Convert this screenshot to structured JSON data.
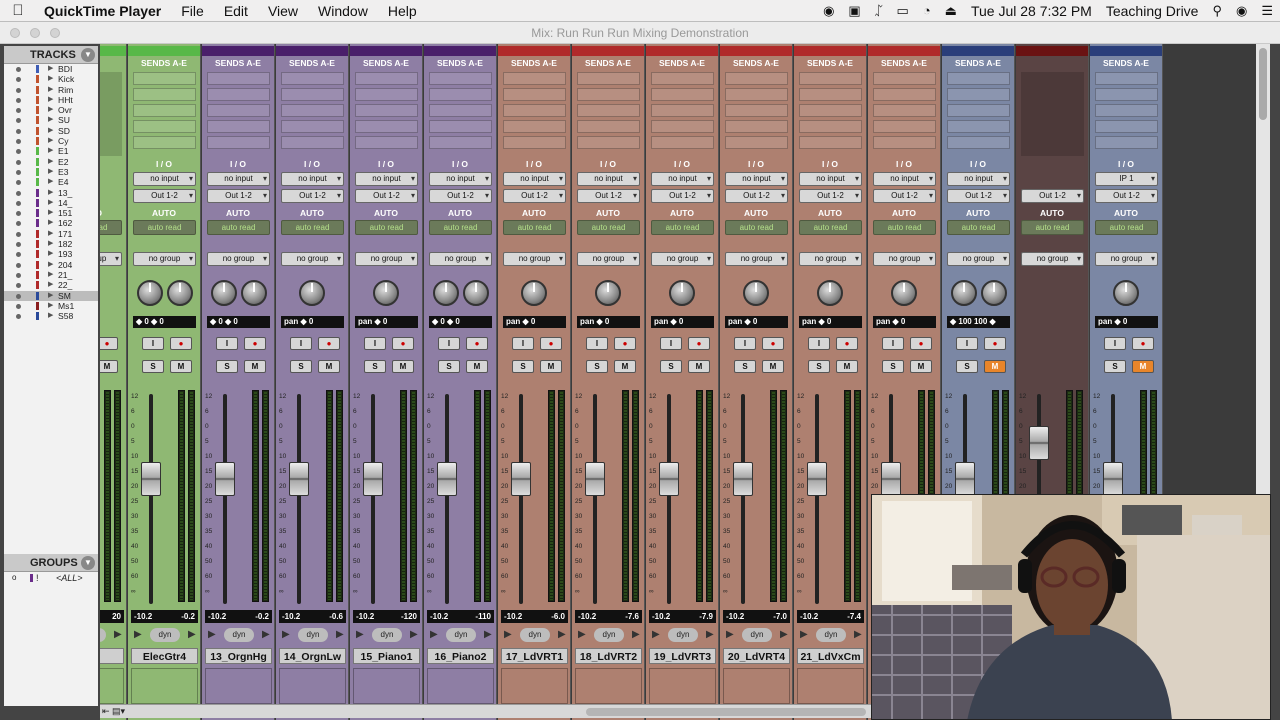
{
  "menubar": {
    "app": "QuickTime Player",
    "items": [
      "File",
      "Edit",
      "View",
      "Window",
      "Help"
    ],
    "datetime": "Tue Jul 28  7:32 PM",
    "user": "Teaching Drive"
  },
  "window_title": "Mix: Run Run Run Mixing Demonstration",
  "sidebar": {
    "tracks_title": "TRACKS",
    "groups_title": "GROUPS",
    "tracks": [
      {
        "name": "BDI",
        "color": "#3e5db5"
      },
      {
        "name": "Kick",
        "color": "#c0522d"
      },
      {
        "name": "Rim",
        "color": "#c0522d"
      },
      {
        "name": "HHt",
        "color": "#c0522d"
      },
      {
        "name": "Ovr",
        "color": "#c0522d"
      },
      {
        "name": "SU",
        "color": "#c0522d"
      },
      {
        "name": "SD",
        "color": "#c0522d"
      },
      {
        "name": "Cy",
        "color": "#c0522d"
      },
      {
        "name": "E1",
        "color": "#58b848"
      },
      {
        "name": "E2",
        "color": "#58b848"
      },
      {
        "name": "E3",
        "color": "#58b848"
      },
      {
        "name": "E4",
        "color": "#58b848"
      },
      {
        "name": "13_",
        "color": "#6a2c8a"
      },
      {
        "name": "14_",
        "color": "#6a2c8a"
      },
      {
        "name": "151",
        "color": "#6a2c8a"
      },
      {
        "name": "162",
        "color": "#6a2c8a"
      },
      {
        "name": "171",
        "color": "#b02a2a"
      },
      {
        "name": "182",
        "color": "#b02a2a"
      },
      {
        "name": "193",
        "color": "#b02a2a"
      },
      {
        "name": "204",
        "color": "#b02a2a"
      },
      {
        "name": "21_",
        "color": "#b02a2a"
      },
      {
        "name": "22_",
        "color": "#b02a2a"
      },
      {
        "name": "SM",
        "color": "#2a4a9a"
      },
      {
        "name": "Ms1",
        "color": "#8a1e1e"
      },
      {
        "name": "S58",
        "color": "#2a4a9a"
      }
    ],
    "groups": [
      {
        "id": "!",
        "name": "<ALL>"
      }
    ]
  },
  "mixer": {
    "strips": [
      {
        "name": "r3",
        "color": "#58b848",
        "bg": "#8fb873",
        "sends": "",
        "io_top": "",
        "output": "",
        "knobs": 0,
        "pan": "",
        "vol": "",
        "vol2": "20",
        "partial": true
      },
      {
        "name": "ElecGtr4",
        "color": "#58b848",
        "bg": "#8fb873",
        "sends": "SENDS A-E",
        "io_top": "I / O",
        "input": "no input",
        "output": "Out 1-2",
        "knobs": 2,
        "pan": "◆ 0 ◆ 0",
        "vol": "-10.2",
        "vol2": "-0.2"
      },
      {
        "name": "13_OrgnHg",
        "color": "#4a1f6a",
        "bg": "#8e7ea4",
        "sends": "SENDS A-E",
        "io_top": "I / O",
        "input": "no input",
        "output": "Out 1-2",
        "knobs": 2,
        "pan": "◆ 0 ◆ 0",
        "vol": "-10.2",
        "vol2": "-0.2"
      },
      {
        "name": "14_OrgnLw",
        "color": "#4a1f6a",
        "bg": "#8e7ea4",
        "sends": "SENDS A-E",
        "io_top": "I / O",
        "input": "no input",
        "output": "Out 1-2",
        "knobs": 1,
        "pan": "pan  ◆ 0",
        "vol": "-10.2",
        "vol2": "-0.6"
      },
      {
        "name": "15_Piano1",
        "color": "#4a1f6a",
        "bg": "#8e7ea4",
        "sends": "SENDS A-E",
        "io_top": "I / O",
        "input": "no input",
        "output": "Out 1-2",
        "knobs": 1,
        "pan": "pan  ◆ 0",
        "vol": "-10.2",
        "vol2": "-120"
      },
      {
        "name": "16_Piano2",
        "color": "#4a1f6a",
        "bg": "#8e7ea4",
        "sends": "SENDS A-E",
        "io_top": "I / O",
        "input": "no input",
        "output": "Out 1-2",
        "knobs": 2,
        "pan": "◆ 0 ◆ 0",
        "vol": "-10.2",
        "vol2": "-110"
      },
      {
        "name": "17_LdVRT1",
        "color": "#b02a2a",
        "bg": "#ae8070",
        "sends": "SENDS A-E",
        "io_top": "I / O",
        "input": "no input",
        "output": "Out 1-2",
        "knobs": 1,
        "pan": "pan  ◆ 0",
        "vol": "-10.2",
        "vol2": "-6.0"
      },
      {
        "name": "18_LdVRT2",
        "color": "#b02a2a",
        "bg": "#ae8070",
        "sends": "SENDS A-E",
        "io_top": "I / O",
        "input": "no input",
        "output": "Out 1-2",
        "knobs": 1,
        "pan": "pan  ◆ 0",
        "vol": "-10.2",
        "vol2": "-7.6"
      },
      {
        "name": "19_LdVRT3",
        "color": "#b02a2a",
        "bg": "#ae8070",
        "sends": "SENDS A-E",
        "io_top": "I / O",
        "input": "no input",
        "output": "Out 1-2",
        "knobs": 1,
        "pan": "pan  ◆ 0",
        "vol": "-10.2",
        "vol2": "-7.9"
      },
      {
        "name": "20_LdVRT4",
        "color": "#b02a2a",
        "bg": "#ae8070",
        "sends": "SENDS A-E",
        "io_top": "I / O",
        "input": "no input",
        "output": "Out 1-2",
        "knobs": 1,
        "pan": "pan  ◆ 0",
        "vol": "-10.2",
        "vol2": "-7.0"
      },
      {
        "name": "21_LdVxCm",
        "color": "#b02a2a",
        "bg": "#ae8070",
        "sends": "SENDS A-E",
        "io_top": "I / O",
        "input": "no input",
        "output": "Out 1-2",
        "knobs": 1,
        "pan": "pan  ◆ 0",
        "vol": "-10.2",
        "vol2": "-7.4"
      },
      {
        "name": "",
        "color": "#b02a2a",
        "bg": "#ae8070",
        "sends": "SENDS A-E",
        "io_top": "I / O",
        "input": "no input",
        "output": "Out 1-2",
        "knobs": 1,
        "pan": "pan  ◆ 0",
        "vol": "",
        "vol2": ""
      },
      {
        "name": "",
        "color": "#2a3e7a",
        "bg": "#7b87a4",
        "sends": "SENDS A-E",
        "io_top": "I / O",
        "input": "no input",
        "output": "Out 1-2",
        "knobs": 2,
        "pan": "◆ 100  100 ◆",
        "vol": "",
        "vol2": "",
        "mute_on": true
      },
      {
        "name": "",
        "color": "#6a1212",
        "bg": "#5a4444",
        "sends": "",
        "io_top": "",
        "input": "",
        "output": "Out 1-2",
        "knobs": 0,
        "pan": "",
        "vol": "",
        "vol2": "",
        "master": true
      },
      {
        "name": "",
        "color": "#2a3e7a",
        "bg": "#7b87a4",
        "sends": "SENDS A-E",
        "io_top": "I / O",
        "input": "IP 1",
        "output": "Out 1-2",
        "knobs": 1,
        "pan": "pan  ◆ 0",
        "vol": "",
        "vol2": "",
        "mute_on": true
      }
    ],
    "auto_label": "AUTO",
    "auto_mode": "auto read",
    "group": "no group",
    "dyn": "dyn"
  }
}
